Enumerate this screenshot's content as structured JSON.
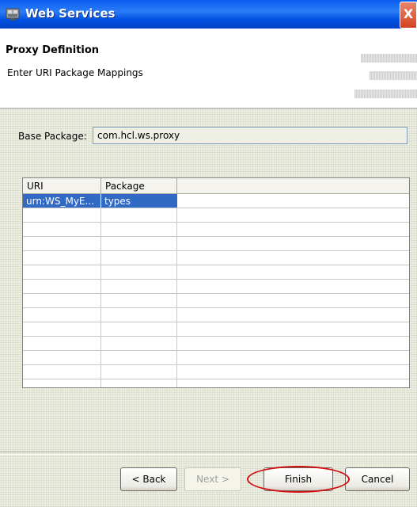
{
  "window": {
    "title": "Web Services",
    "close_label": "X",
    "icon": "web-services-icon"
  },
  "header": {
    "title": "Proxy Definition",
    "description": "Enter URI Package Mappings"
  },
  "base_package": {
    "label": "Base Package:",
    "value": "com.hcl.ws.proxy"
  },
  "table": {
    "columns": [
      "URI",
      "Package"
    ],
    "rows": [
      {
        "uri": "urn:WS_MyE...",
        "package": "types",
        "selected": true
      }
    ]
  },
  "buttons": {
    "back": "< Back",
    "next": "Next >",
    "finish": "Finish",
    "cancel": "Cancel"
  },
  "colors": {
    "title_bar": "#0a5ef0",
    "selection": "#316ac5",
    "annotation": "#d01010"
  }
}
